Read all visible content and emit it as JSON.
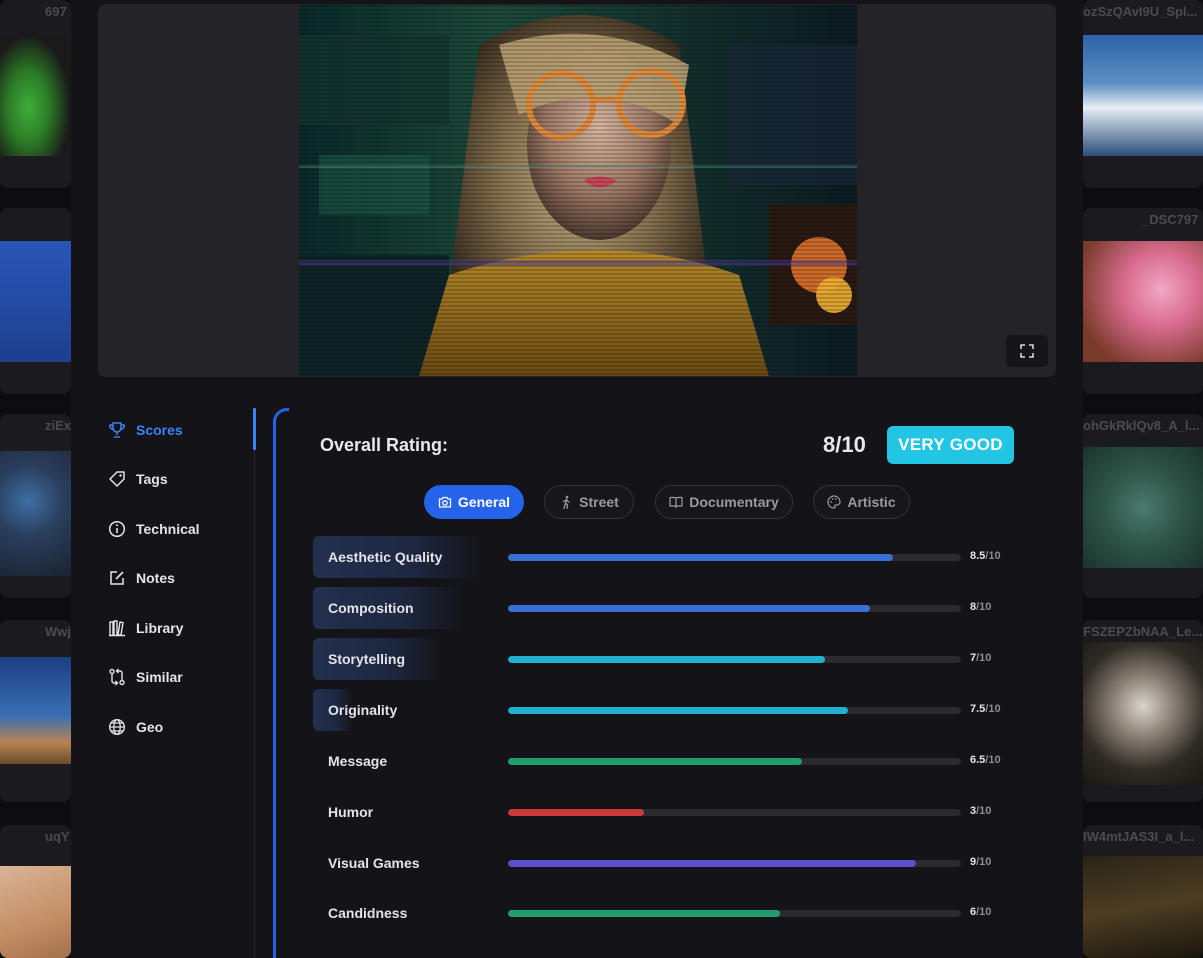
{
  "background": {
    "left_cards": [
      {
        "caption": "697"
      },
      {
        "caption": ""
      },
      {
        "caption": "ziEx"
      },
      {
        "caption": "Wwj"
      },
      {
        "caption": "uqY"
      }
    ],
    "right_cards": [
      {
        "caption": "ozSzQAvI9U_Spl..."
      },
      {
        "caption": "_DSC797"
      },
      {
        "caption": "ohGkRklQv8_A_l..."
      },
      {
        "caption": "FSZEPZbNAA_Le..."
      },
      {
        "caption": "IW4mtJAS3I_a_l..."
      }
    ]
  },
  "viewer": {
    "fullscreen_icon": "fullscreen-icon"
  },
  "sidebar": {
    "items": [
      {
        "label": "Scores",
        "icon": "trophy-icon",
        "active": true
      },
      {
        "label": "Tags",
        "icon": "tag-icon"
      },
      {
        "label": "Technical",
        "icon": "info-icon"
      },
      {
        "label": "Notes",
        "icon": "edit-icon"
      },
      {
        "label": "Library",
        "icon": "library-icon"
      },
      {
        "label": "Similar",
        "icon": "compare-icon"
      },
      {
        "label": "Geo",
        "icon": "globe-icon"
      }
    ]
  },
  "scores": {
    "overall_label": "Overall Rating:",
    "overall_value": "8/10",
    "verdict": "VERY GOOD",
    "verdict_color": "#22c5e4",
    "tabs": [
      {
        "label": "General",
        "icon": "camera-icon",
        "active": true
      },
      {
        "label": "Street",
        "icon": "walking-icon"
      },
      {
        "label": "Documentary",
        "icon": "book-icon"
      },
      {
        "label": "Artistic",
        "icon": "palette-icon"
      }
    ],
    "criteria": [
      {
        "label": "Aesthetic Quality",
        "score": "8.5",
        "max": "/10",
        "value": 8.5,
        "color": "#3b6fd4"
      },
      {
        "label": "Composition",
        "score": "8",
        "max": "/10",
        "value": 8,
        "color": "#3b6fd4"
      },
      {
        "label": "Storytelling",
        "score": "7",
        "max": "/10",
        "value": 7,
        "color": "#22b0cf"
      },
      {
        "label": "Originality",
        "score": "7.5",
        "max": "/10",
        "value": 7.5,
        "color": "#22b0cf"
      },
      {
        "label": "Message",
        "score": "6.5",
        "max": "/10",
        "value": 6.5,
        "color": "#1f9f6d"
      },
      {
        "label": "Humor",
        "score": "3",
        "max": "/10",
        "value": 3,
        "color": "#c9393b"
      },
      {
        "label": "Visual Games",
        "score": "9",
        "max": "/10",
        "value": 9,
        "color": "#5b4fd0"
      },
      {
        "label": "Candidness",
        "score": "6",
        "max": "/10",
        "value": 6,
        "color": "#1f9f6d"
      }
    ]
  }
}
